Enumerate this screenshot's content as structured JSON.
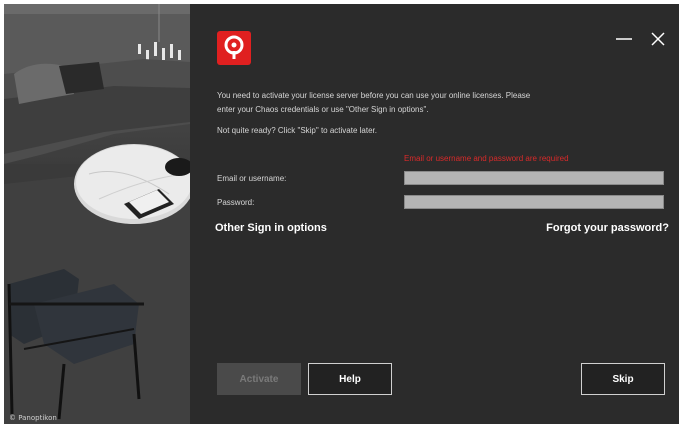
{
  "photo": {
    "credit": "© Panoptikon"
  },
  "window": {
    "minimize_icon": "minus-icon",
    "close_icon": "close-icon"
  },
  "dialog": {
    "message_line1": "You need to activate your license server before you can use your online licenses. Please enter your Chaos credentials or use \"Other Sign in options\".",
    "message_line2": "Not quite ready? Click \"Skip\" to activate later.",
    "error": "Email or username and password are required",
    "email_label": "Email or username:",
    "email_value": "",
    "password_label": "Password:",
    "password_value": "",
    "other_signin": "Other Sign in options",
    "forgot_password": "Forgot your password?"
  },
  "buttons": {
    "activate": "Activate",
    "help": "Help",
    "skip": "Skip"
  },
  "colors": {
    "accent": "#e02020",
    "error": "#d92a2a",
    "background": "#2b2b2b"
  }
}
